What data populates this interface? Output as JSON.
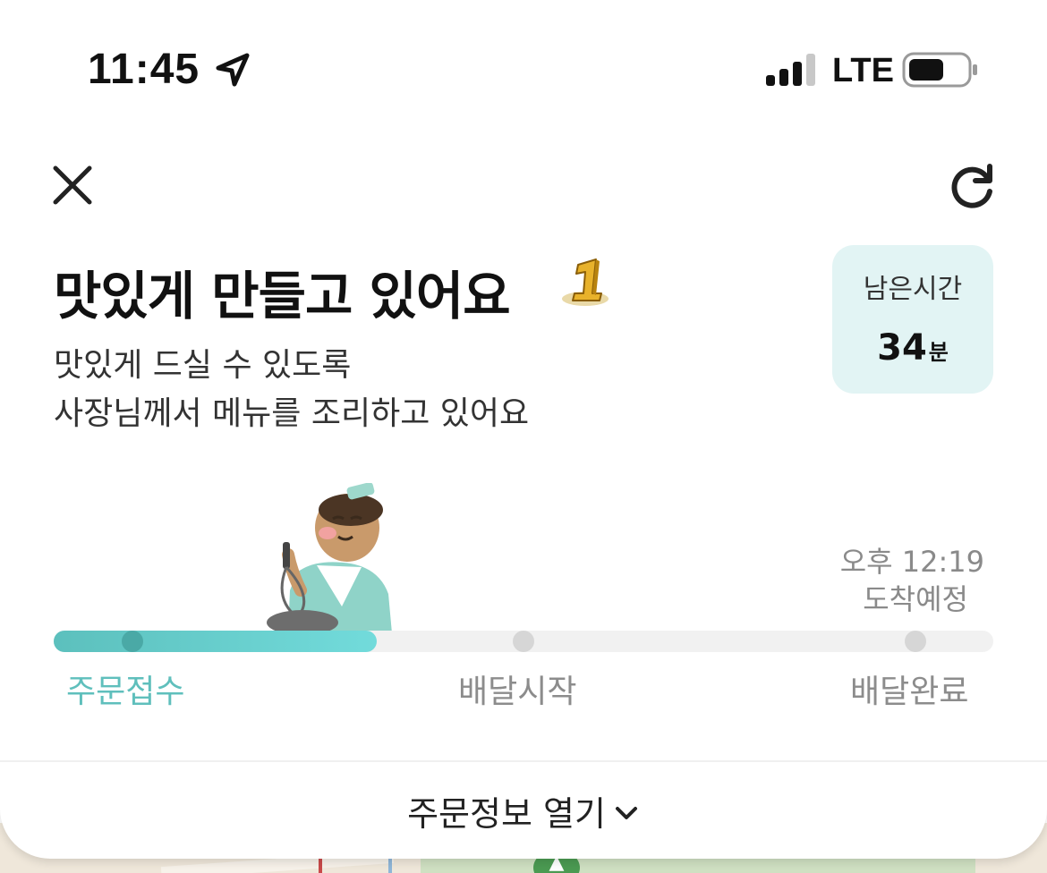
{
  "status_bar": {
    "time": "11:45",
    "network": "LTE",
    "location_icon": "location-arrow-icon",
    "signal_icon": "cellular-signal-icon",
    "battery_icon": "battery-icon"
  },
  "nav": {
    "close_icon": "close-icon",
    "refresh_icon": "refresh-icon"
  },
  "header": {
    "title": "맛있게 만들고 있어요",
    "subtitle_line1": "맛있게 드실 수 있도록",
    "subtitle_line2": "사장님께서 메뉴를 조리하고 있어요"
  },
  "remaining": {
    "label": "남은시간",
    "value": "34",
    "unit": "분"
  },
  "eta": {
    "time": "오후 12:19",
    "label": "도착예정"
  },
  "progress": {
    "fraction": 0.344,
    "steps": [
      "주문접수",
      "배달시작",
      "배달완료"
    ],
    "active_step": 0
  },
  "order_info": {
    "label": "주문정보 열기"
  },
  "colors": {
    "accent": "#5fbfbc",
    "progress_start": "#5cc0bd",
    "progress_end": "#72dbdb",
    "card_bg": "#e2f4f4",
    "inactive": "#8c8c8c"
  }
}
